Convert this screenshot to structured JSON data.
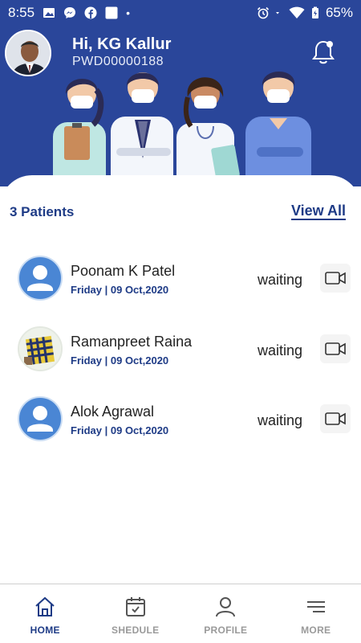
{
  "status_bar": {
    "time": "8:55",
    "battery": "65%",
    "dot": "•"
  },
  "header": {
    "greeting": "Hi, KG  Kallur",
    "user_id": "PWD00000188"
  },
  "patients_section": {
    "count_label": "3 Patients",
    "view_all_label": "View All"
  },
  "patients": [
    {
      "name": "Poonam K Patel",
      "date": "Friday | 09 Oct,2020",
      "status": "waiting",
      "avatar": "person-placeholder"
    },
    {
      "name": "Ramanpreet Raina",
      "date": "Friday | 09 Oct,2020",
      "status": "waiting",
      "avatar": "plaid-photo"
    },
    {
      "name": "Alok  Agrawal",
      "date": "Friday | 09 Oct,2020",
      "status": "waiting",
      "avatar": "person-placeholder"
    }
  ],
  "bottom_nav": [
    {
      "label": "HOME",
      "icon": "home-icon",
      "active": true
    },
    {
      "label": "SHEDULE",
      "icon": "calendar-icon",
      "active": false
    },
    {
      "label": "PROFILE",
      "icon": "profile-icon",
      "active": false
    },
    {
      "label": "MORE",
      "icon": "menu-icon",
      "active": false
    }
  ],
  "colors": {
    "primary": "#2a469a",
    "accent_text": "#1e3b86",
    "avatar_blue": "#4a86d4"
  }
}
